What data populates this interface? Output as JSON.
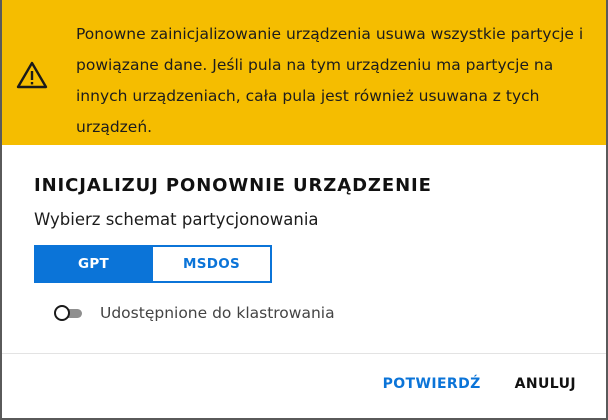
{
  "banner": {
    "icon": "warning-triangle-icon",
    "background": "#f5bd00",
    "lines": [
      "Ponowne zainicjalizowanie urządzenia usuwa wszystkie partycje i",
      "powiązane dane. Jeśli pula na tym urządzeniu ma partycje na",
      "innych urządzeniach, cała pula jest również usuwana z tych",
      "urządzeń."
    ]
  },
  "dialog": {
    "title": "INICJALIZUJ PONOWNIE URZĄDZENIE",
    "subtitle": "Wybierz schemat partycjonowania",
    "scheme": {
      "options": [
        "GPT",
        "MSDOS"
      ],
      "selected": "GPT",
      "accent": "#0b74d8"
    },
    "cluster_toggle": {
      "label": "Udostępnione do klastrowania",
      "checked": false
    },
    "actions": {
      "confirm": "POTWIERDŹ",
      "cancel": "ANULUJ"
    }
  }
}
